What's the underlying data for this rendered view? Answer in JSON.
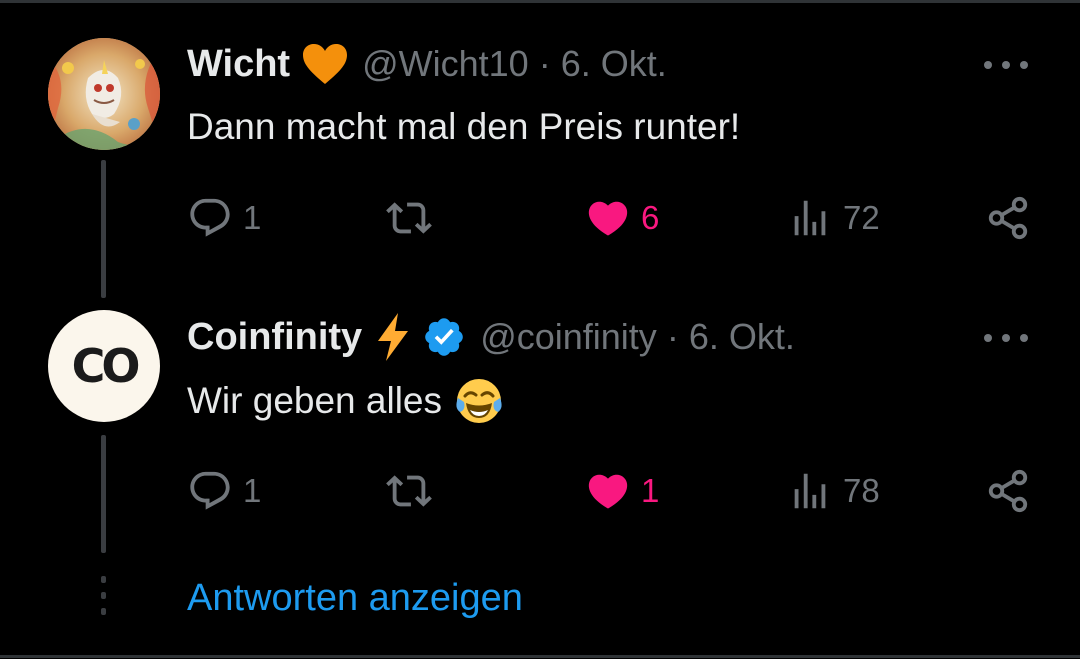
{
  "tweets": [
    {
      "name": "Wicht",
      "badge": "orange-heart-emoji",
      "handle": "@Wicht10",
      "separator": "·",
      "date": "6. Okt.",
      "text": "Dann macht mal den Preis runter!",
      "emoji": "",
      "stats": {
        "replies": "1",
        "retweets": "",
        "likes": "6",
        "views": "72"
      },
      "liked": true
    },
    {
      "name": "Coinfinity",
      "badge": "lightning-emoji + verified-badge",
      "avatar_text": "CO",
      "handle": "@coinfinity",
      "separator": "·",
      "date": "6. Okt.",
      "text": "Wir geben alles",
      "emoji": "face-with-tears-of-joy-emoji",
      "stats": {
        "replies": "1",
        "retweets": "",
        "likes": "1",
        "views": "78"
      },
      "liked": true
    }
  ],
  "show_replies_label": "Antworten anzeigen",
  "colors": {
    "background": "#000000",
    "text_primary": "#e7e9ea",
    "text_secondary": "#71767b",
    "like_pink": "#f91880",
    "link_blue": "#1d9bf0",
    "verified_blue": "#1d9bf0",
    "orange_heart": "#f4900c",
    "lightning": "#ffac33"
  }
}
